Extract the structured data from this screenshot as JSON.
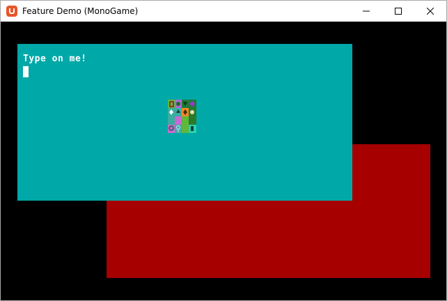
{
  "window": {
    "title": "Feature Demo (MonoGame)",
    "icon": "monogame-logo-icon"
  },
  "controls": {
    "minimize_icon": "minimize-icon",
    "maximize_icon": "maximize-icon",
    "close_icon": "close-icon"
  },
  "canvas": {
    "background": "#000000",
    "teal_panel_color": "#00a8a8",
    "red_panel_color": "#a60000",
    "prompt": "Type on me!",
    "text_color": "#ffffff",
    "sprite": "symbol-tileset-icon"
  }
}
